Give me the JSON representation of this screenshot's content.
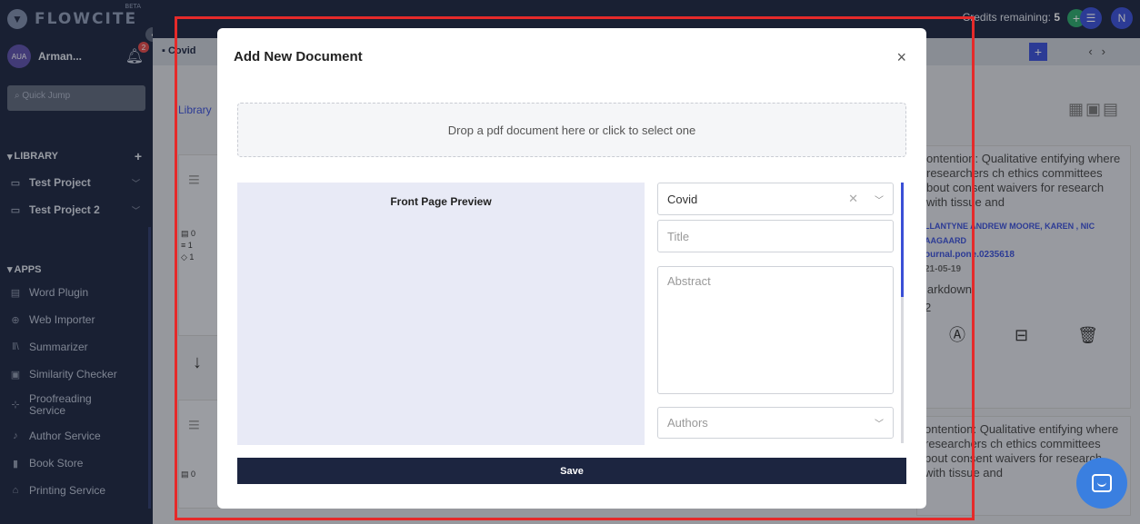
{
  "app": {
    "logo_text": "FLOWCITE",
    "beta_label": "BETA",
    "credits_label": "Credits remaining:",
    "credits_value": "5"
  },
  "user": {
    "initials": "AUA",
    "name": "Arman...",
    "notification_count": "2"
  },
  "sidebar": {
    "quick_jump_placeholder": "Quick Jump",
    "library_heading": "LIBRARY",
    "projects": [
      {
        "label": "Test Project"
      },
      {
        "label": "Test Project 2"
      }
    ],
    "apps_heading": "APPS",
    "apps": [
      {
        "label": "Word Plugin",
        "icon": "word-icon"
      },
      {
        "label": "Web Importer",
        "icon": "globe-icon"
      },
      {
        "label": "Summarizer",
        "icon": "summarizer-icon"
      },
      {
        "label": "Similarity Checker",
        "icon": "similarity-icon"
      },
      {
        "label": "Proofreading Service",
        "icon": "proofreading-icon"
      },
      {
        "label": "Author Service",
        "icon": "author-icon"
      },
      {
        "label": "Book Store",
        "icon": "book-icon"
      },
      {
        "label": "Printing Service",
        "icon": "print-icon"
      }
    ]
  },
  "background": {
    "breadcrumb": "Covid",
    "library_link": "Library",
    "left_card_stats": [
      "0",
      "1",
      "1"
    ],
    "left_card2_stat": "0",
    "right_card": {
      "title": "ontention: Qualitative entifying where researchers ch ethics committees bout consent waivers for research with tissue and",
      "authors": "LLANTYNE ANDREW MOORE, KAREN , NIC AAGAARD",
      "doi": "ournal.pone.0235618",
      "date": "21-05-19",
      "tag": "larkdown",
      "count": "2"
    },
    "right_card2_title": "ontention: Qualitative entifying where researchers ch ethics committees bout consent waivers for research with tissue and"
  },
  "modal": {
    "title": "Add New Document",
    "close_label": "×",
    "dropzone_text": "Drop a pdf document here or click to select one",
    "preview_label": "Front Page Preview",
    "project_select_value": "Covid",
    "title_placeholder": "Title",
    "abstract_placeholder": "Abstract",
    "authors_placeholder": "Authors",
    "save_label": "Save"
  },
  "colors": {
    "sidebar_bg": "#1c2540",
    "accent": "#3a4fd6",
    "highlight": "#e52a2a",
    "preview_bg": "#e8eaf6"
  }
}
